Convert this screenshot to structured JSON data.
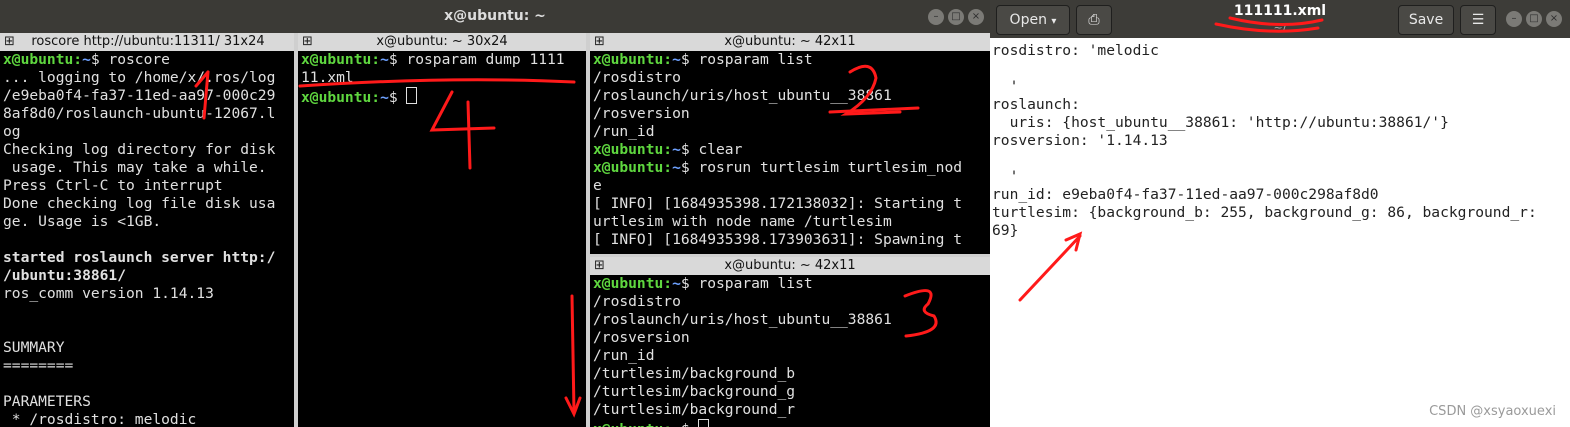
{
  "terminal": {
    "window_title": "x@ubuntu: ~",
    "panes": [
      {
        "header": "roscore http://ubuntu:11311/ 31x24",
        "lines": [
          {
            "user": "x@ubuntu",
            "path": "~",
            "cmd": "$ roscore"
          },
          {
            "text": "... logging to /home/x/.ros/log"
          },
          {
            "text": "/e9eba0f4-fa37-11ed-aa97-000c29"
          },
          {
            "text": "8af8d0/roslaunch-ubuntu-12067.l"
          },
          {
            "text": "og"
          },
          {
            "text": "Checking log directory for disk"
          },
          {
            "text": " usage. This may take a while."
          },
          {
            "text": "Press Ctrl-C to interrupt"
          },
          {
            "text": "Done checking log file disk usa"
          },
          {
            "text": "ge. Usage is <1GB."
          },
          {
            "text": ""
          },
          {
            "text": "started roslaunch server http:/",
            "bold": true
          },
          {
            "text": "/ubuntu:38861/",
            "bold": true
          },
          {
            "text": "ros_comm version 1.14.13"
          },
          {
            "text": ""
          },
          {
            "text": ""
          },
          {
            "text": "SUMMARY"
          },
          {
            "text": "========"
          },
          {
            "text": ""
          },
          {
            "text": "PARAMETERS"
          },
          {
            "text": " * /rosdistro: melodic"
          }
        ]
      },
      {
        "header": "x@ubuntu: ~ 30x24",
        "lines": [
          {
            "user": "x@ubuntu",
            "path": "~",
            "cmd": "$ rosparam dump 1111"
          },
          {
            "text": "11.xml"
          },
          {
            "user": "x@ubuntu",
            "path": "~",
            "cmd": "$ ",
            "cursor": true
          }
        ]
      },
      {
        "header": "x@ubuntu: ~ 42x11",
        "lines": [
          {
            "user": "x@ubuntu",
            "path": "~",
            "cmd": "$ rosparam list"
          },
          {
            "text": "/rosdistro"
          },
          {
            "text": "/roslaunch/uris/host_ubuntu__38861"
          },
          {
            "text": "/rosversion"
          },
          {
            "text": "/run_id"
          },
          {
            "user": "x@ubuntu",
            "path": "~",
            "cmd": "$ clear"
          },
          {
            "user": "x@ubuntu",
            "path": "~",
            "cmd": "$ rosrun turtlesim turtlesim_nod"
          },
          {
            "text": "e"
          },
          {
            "text": "[ INFO] [1684935398.172138032]: Starting t"
          },
          {
            "text": "urtlesim with node name /turtlesim"
          },
          {
            "text": "[ INFO] [1684935398.173903631]: Spawning t"
          }
        ]
      },
      {
        "header": "x@ubuntu: ~ 42x11",
        "lines": [
          {
            "user": "x@ubuntu",
            "path": "~",
            "cmd": "$ rosparam list"
          },
          {
            "text": "/rosdistro"
          },
          {
            "text": "/roslaunch/uris/host_ubuntu__38861"
          },
          {
            "text": "/rosversion"
          },
          {
            "text": "/run_id"
          },
          {
            "text": "/turtlesim/background_b"
          },
          {
            "text": "/turtlesim/background_g"
          },
          {
            "text": "/turtlesim/background_r"
          },
          {
            "user": "x@ubuntu",
            "path": "~",
            "cmd": "$ ",
            "cursor": true
          }
        ]
      }
    ]
  },
  "gedit": {
    "open_label": "Open",
    "file_name": "111111.xml",
    "file_path": "~/",
    "save_label": "Save",
    "lines": [
      "rosdistro: 'melodic",
      "",
      "  '",
      "roslaunch:",
      "  uris: {host_ubuntu__38861: 'http://ubuntu:38861/'}",
      "rosversion: '1.14.13",
      "",
      "  '",
      "run_id: e9eba0f4-fa37-11ed-aa97-000c298af8d0",
      "turtlesim: {background_b: 255, background_g: 86, background_r:",
      "69}"
    ]
  },
  "annotations": [
    "1",
    "2",
    "3",
    "4"
  ],
  "watermark": "CSDN @xsyaoxuexi",
  "colors": {
    "prompt_user": "#5fd73f",
    "prompt_path": "#6ea1ff",
    "annotation": "#ff1a1a"
  }
}
